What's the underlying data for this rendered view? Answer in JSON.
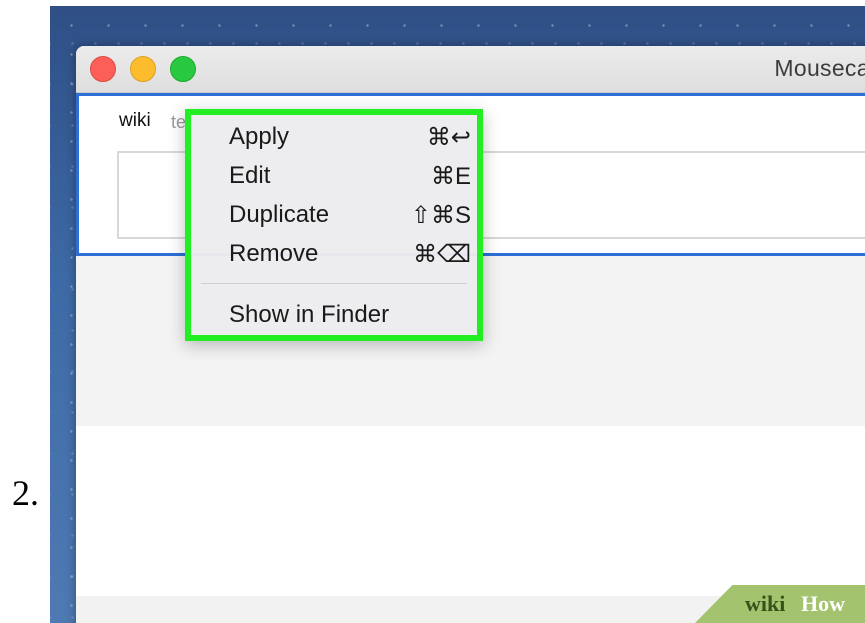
{
  "step": {
    "number": "2."
  },
  "window": {
    "title": "Mousecape",
    "cape": {
      "name": "wiki",
      "author_partial": "te"
    }
  },
  "context_menu": {
    "items": [
      {
        "label": "Apply",
        "shortcut": "⌘↩"
      },
      {
        "label": "Edit",
        "shortcut": "⌘E"
      },
      {
        "label": "Duplicate",
        "shortcut": "⇧⌘S"
      },
      {
        "label": "Remove",
        "shortcut": "⌘⌫"
      },
      {
        "label": "Show in Finder",
        "shortcut": ""
      }
    ],
    "highlight_color": "#22ee22"
  },
  "watermark": {
    "wiki": "wiki",
    "how": "How"
  },
  "colors": {
    "selection_border": "#2e6fd6",
    "close": "#fc5f57",
    "minimize": "#fdbc2e",
    "maximize": "#28c840"
  }
}
